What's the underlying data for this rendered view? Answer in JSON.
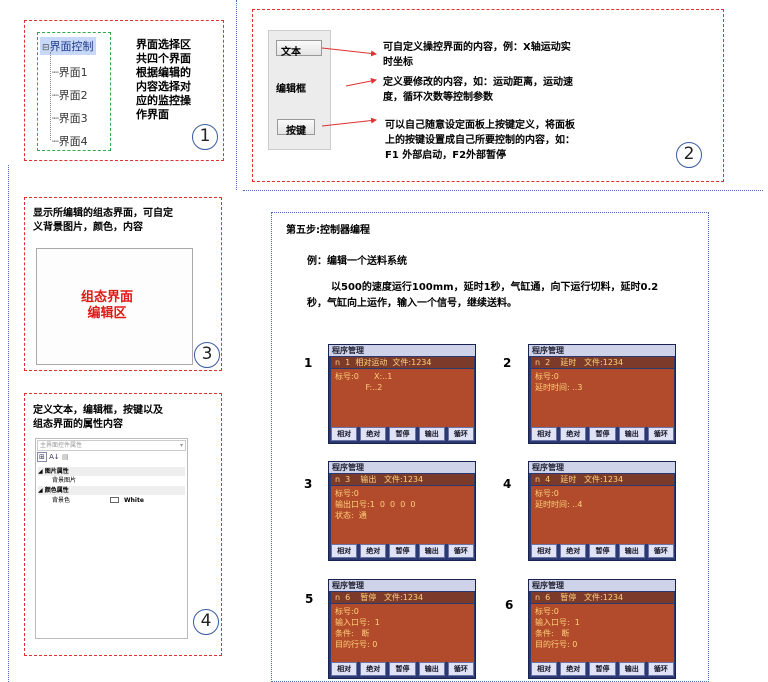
{
  "panel1": {
    "tree_root": "界面控制",
    "tree_items": [
      "界面1",
      "界面2",
      "界面3",
      "界面4"
    ],
    "desc": [
      "界面选择区",
      "共四个界面",
      "根据编辑的",
      "内容选择对",
      "应的监控操",
      "作界面"
    ],
    "num": "1"
  },
  "panel2": {
    "items": [
      {
        "label": "文本",
        "desc": [
          "可自定义操控界面的内容，例：X轴运动实",
          "时坐标"
        ]
      },
      {
        "label": "编辑框",
        "desc": [
          "定义要修改的内容，如：运动距离，运动速",
          "度，循环次数等控制参数"
        ]
      },
      {
        "label": "按键",
        "desc": [
          "可以自己随意设定面板上按键定义，将面板",
          "上的按键设置成自己所要控制的内容，如：",
          "F1 外部启动，F2外部暂停"
        ]
      }
    ],
    "num": "2"
  },
  "panel3": {
    "desc": [
      "显示所编辑的组态界面，可自定",
      "义背景图片，颜色，内容"
    ],
    "canvas": [
      "组态界面",
      "编辑区"
    ],
    "num": "3"
  },
  "panel4": {
    "desc": [
      "定义文本，编辑框，按键以及",
      "组态界面的属性内容"
    ],
    "dropdown": "主界面控件属性",
    "rows": [
      {
        "t": "图片属性",
        "group": true
      },
      {
        "t": "背景图片",
        "group": false
      },
      {
        "t": "颜色属性",
        "group": true
      },
      {
        "t": "背景色",
        "group": false,
        "value": "White"
      }
    ],
    "num": "4"
  },
  "step": {
    "title": "第五步:控制器编程",
    "example": "例：编辑一个送料系统",
    "para": [
      "以500的速度运行100mm，延时1秒，气缸通，向下运行切料，延时0.2",
      "秒，气缸向上运作，输入一个信号，继续送料。"
    ]
  },
  "screens": [
    {
      "n": "1",
      "title": "程序管理",
      "head": "n  1  相对运动  文件:1234",
      "body": "标号:0      X:..1\n            F:..2"
    },
    {
      "n": "2",
      "title": "程序管理",
      "head": "n  2    延时   文件:1234",
      "body": "标号:0\n延时时间: ..3"
    },
    {
      "n": "3",
      "title": "程序管理",
      "head": "n  3    输出   文件:1234",
      "body": "标号:0\n输出口号:1  0  0  0  0\n状态:  通"
    },
    {
      "n": "4",
      "title": "程序管理",
      "head": "n  4    延时   文件:1234",
      "body": "标号:0\n延时时间: ..4"
    },
    {
      "n": "5",
      "title": "程序管理",
      "head": "n  6    暂停   文件:1234",
      "body": "标号:0\n输入口号:  1\n条件:   断\n目的行号: 0"
    },
    {
      "n": "6",
      "title": "程序管理",
      "head": "n  6    暂停   文件:1234",
      "body": "标号:0\n输入口号:  1\n条件:   断\n目的行号: 0"
    }
  ],
  "screen_buttons": [
    "相对",
    "绝对",
    "暂停",
    "输出",
    "循环"
  ]
}
